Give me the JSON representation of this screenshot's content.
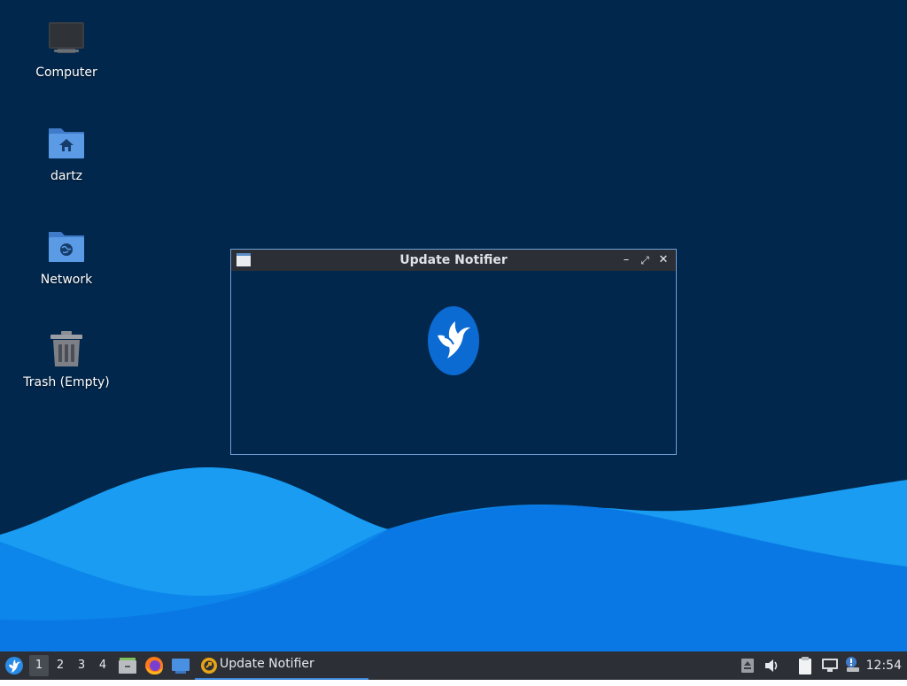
{
  "desktop": {
    "icons": [
      {
        "label": "Computer",
        "icon": "computer-icon"
      },
      {
        "label": "dartz",
        "icon": "home-folder-icon"
      },
      {
        "label": "Network",
        "icon": "network-folder-icon"
      },
      {
        "label": "Trash (Empty)",
        "icon": "trash-icon"
      }
    ]
  },
  "window": {
    "title": "Update Notifier",
    "app_icon": "window-icon",
    "controls": {
      "minimize": "minimize-icon",
      "maximize": "maximize-icon",
      "close": "close-icon"
    },
    "logo": "lubuntu-bird-icon"
  },
  "panel": {
    "menu_icon": "lubuntu-menu-icon",
    "workspaces": [
      "1",
      "2",
      "3",
      "4"
    ],
    "active_workspace": "1",
    "launchers": [
      "file-manager-icon",
      "firefox-icon",
      "show-desktop-icon"
    ],
    "task": {
      "label": "Update Notifier",
      "icon": "update-notifier-icon"
    },
    "tray": [
      "removable-media-icon",
      "volume-icon",
      "clipboard-icon",
      "network-icon",
      "update-tray-icon"
    ],
    "clock": "12:54"
  },
  "colors": {
    "desktop_bg": "#02274c",
    "panel_bg": "#2c3036",
    "accent": "#3b86d8",
    "wave_light": "#1a9cf2",
    "wave_dark": "#0a6ee0"
  }
}
